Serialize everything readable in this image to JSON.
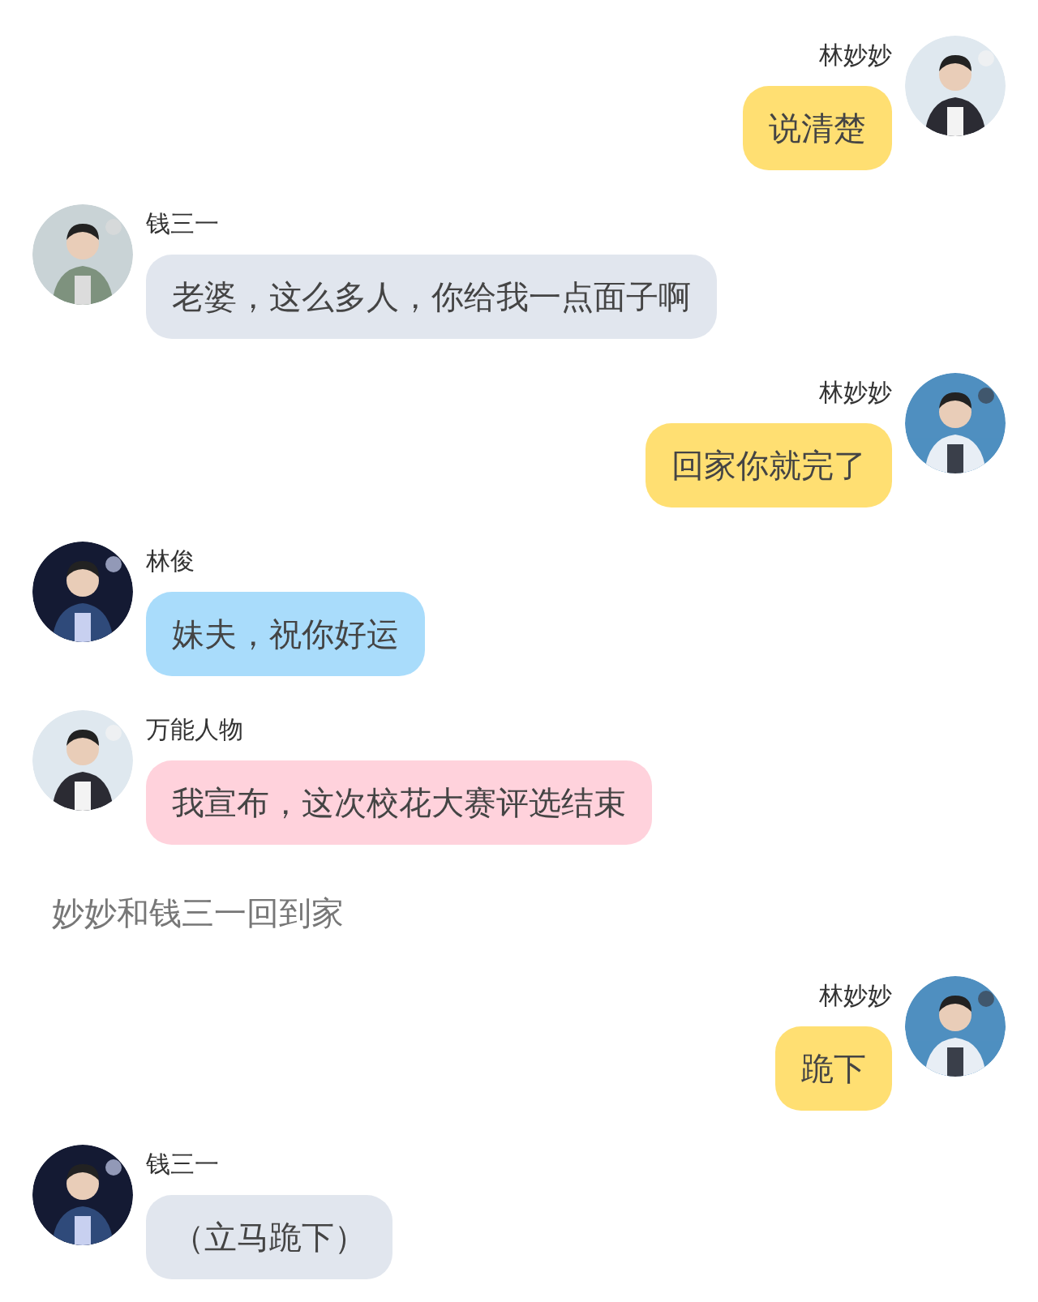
{
  "messages": [
    {
      "kind": "outgoing",
      "sender": "林妙妙",
      "text": "说清楚",
      "color": "#ffdf72"
    },
    {
      "kind": "incoming",
      "sender": "钱三一",
      "text": "老婆，这么多人，你给我一点面子啊",
      "color": "#e1e6ee"
    },
    {
      "kind": "outgoing",
      "sender": "林妙妙",
      "text": "回家你就完了",
      "color": "#ffdf72"
    },
    {
      "kind": "incoming",
      "sender": "林俊",
      "text": "妹夫，祝你好运",
      "color": "#a9dcfb"
    },
    {
      "kind": "incoming",
      "sender": "万能人物",
      "text": "我宣布，这次校花大赛评选结束",
      "color": "#ffd2dc"
    },
    {
      "kind": "narration",
      "text": "妙妙和钱三一回到家"
    },
    {
      "kind": "outgoing",
      "sender": "林妙妙",
      "text": "跪下",
      "color": "#ffdf72"
    },
    {
      "kind": "incoming",
      "sender": "钱三一",
      "text": "（立马跪下）",
      "color": "#e1e6ee"
    }
  ]
}
